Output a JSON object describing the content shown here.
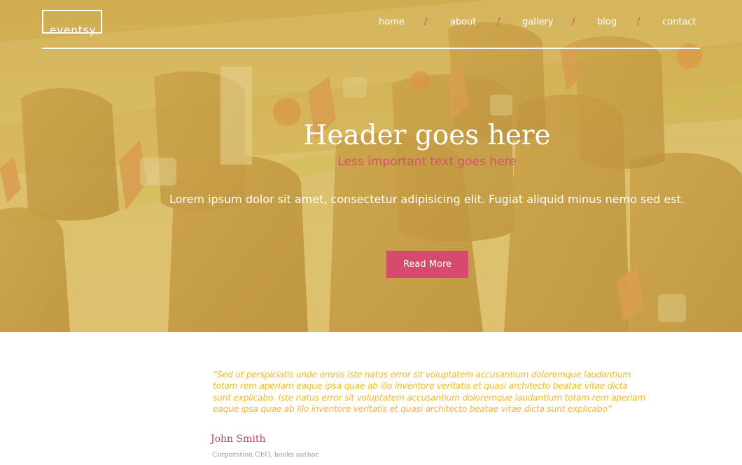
{
  "brand": {
    "logo_text": "eventsy"
  },
  "nav": {
    "items": [
      {
        "label": "home"
      },
      {
        "label": "about"
      },
      {
        "label": "gallery"
      },
      {
        "label": "blog"
      },
      {
        "label": "contact"
      }
    ],
    "separator": "/"
  },
  "hero": {
    "title": "Header goes here",
    "subtitle": "Less important text goes here",
    "text": "Lorem ipsum dolor sit amet, consectetur adipisicing elit. Fugiat aliquid minus nemo sed est.",
    "button_label": "Read More"
  },
  "testimonial": {
    "quote": "“Sed ut perspiciatis unde omnis iste natus error sit voluptatem accusantium doloremque laudantium totam rem aperiam eaque ipsa quae ab illo inventore veritatis et quasi architecto beatae vitae dicta sunt explicabo. Iste natus error sit voluptatem accusantium doloremque laudantium totam rem aperiam eaque ipsa quae ab illo inventore veritatis et quasi architecto beatae vitae dicta sunt explicabo”",
    "author": "John Smith",
    "author_title": "Corporation CEO, books author."
  },
  "colors": {
    "accent": "#d64b6d",
    "quote": "#f2b81c",
    "hero_tint": "#d6b646"
  }
}
